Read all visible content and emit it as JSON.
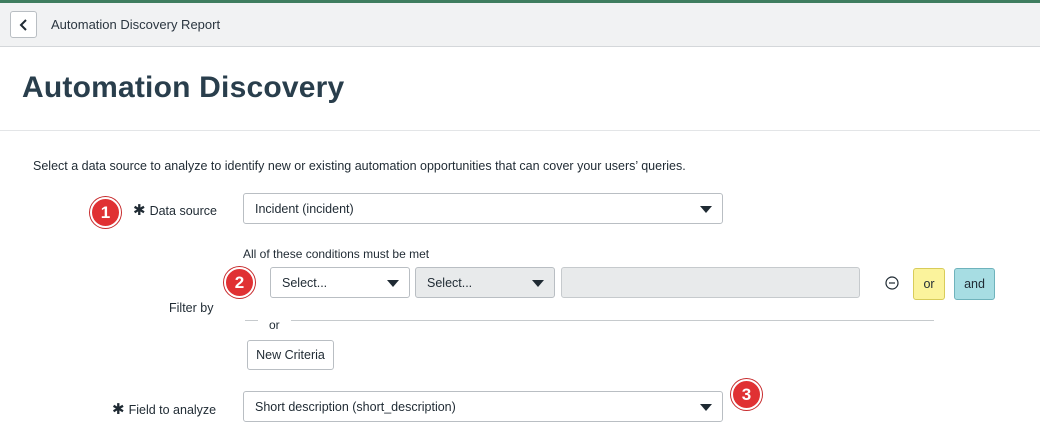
{
  "nav": {
    "title": "Automation Discovery Report",
    "back_icon": "chevron-left-icon"
  },
  "page": {
    "title": "Automation Discovery"
  },
  "intro": "Select a data source to analyze to identify new or existing automation opportunities that can cover your users’ queries.",
  "badges": {
    "step1": "1",
    "step2": "2",
    "step3": "3"
  },
  "data_source": {
    "label": "Data source",
    "value": "Incident (incident)"
  },
  "filter": {
    "label": "Filter by",
    "conditions_label": "All of these conditions must be met",
    "field_select": "Select...",
    "operator_select": "Select...",
    "value_input": "",
    "or_label": "or",
    "and_label": "and",
    "divider_or": "or",
    "new_criteria": "New Criteria"
  },
  "field_to_analyze": {
    "label": "Field to analyze",
    "value": "Short description (short_description)"
  },
  "colors": {
    "accent": "#3f7d5f",
    "badge": "#e03133",
    "or_button": "#fbf39c",
    "and_button": "#a7dde3"
  }
}
